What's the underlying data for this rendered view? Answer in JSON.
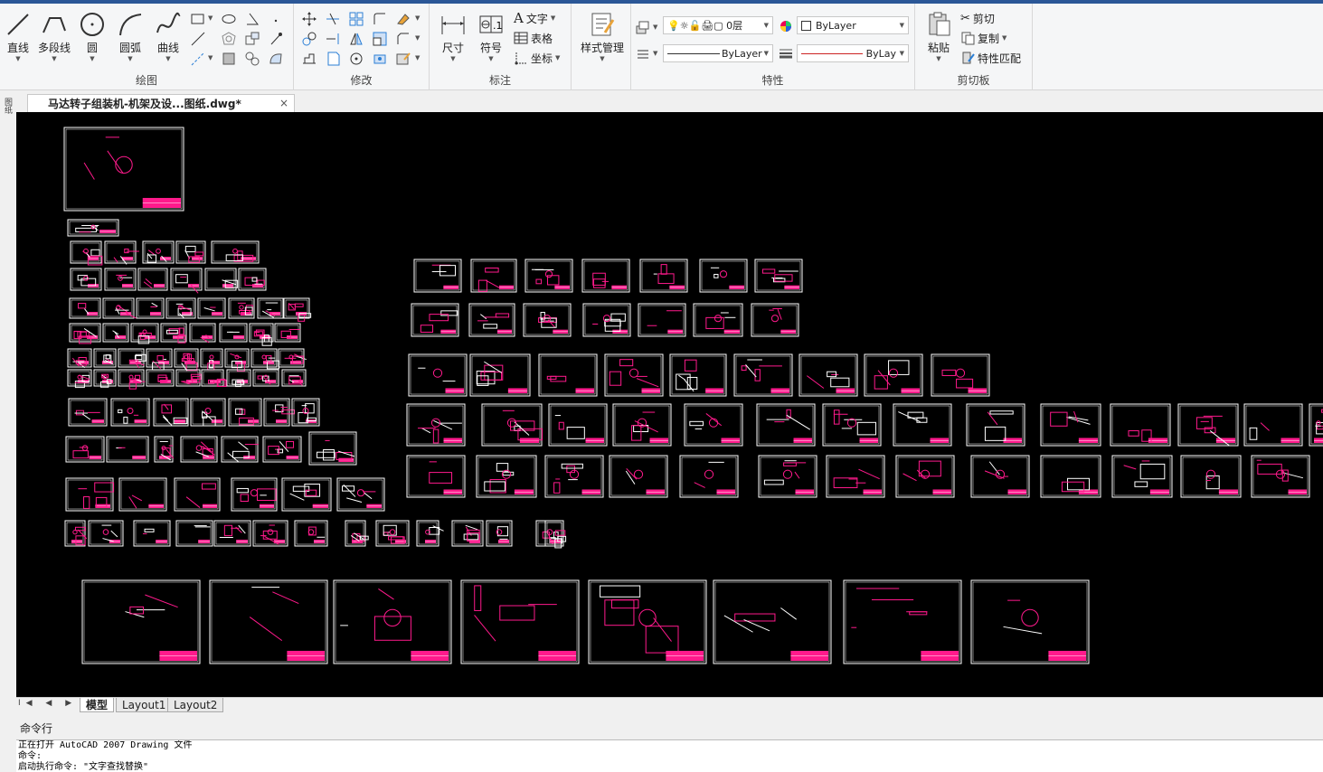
{
  "ribbon": {
    "draw": {
      "label": "绘图",
      "line": "直线",
      "polyline": "多段线",
      "circle": "圆",
      "arc": "圆弧",
      "curve": "曲线"
    },
    "modify": {
      "label": "修改"
    },
    "annotate": {
      "label": "标注",
      "dimension": "尺寸",
      "symbol": "符号",
      "text": "文字",
      "table": "表格",
      "coord": "坐标"
    },
    "style": {
      "label": "样式管理"
    },
    "properties": {
      "label": "特性",
      "layer_value": "0层",
      "color_value": "ByLayer",
      "linetype_value": "ByLayer",
      "lineweight_value": "ByLay"
    },
    "clipboard": {
      "label": "剪切板",
      "paste": "粘贴",
      "cut": "剪切",
      "copy": "复制",
      "match": "特性匹配"
    }
  },
  "document": {
    "tab_title": "马达转子组装机-机架及设...图纸.dwg*",
    "close_glyph": "×"
  },
  "left_strip": {
    "text": "图纸"
  },
  "layout_tabs": {
    "nav": "I◀ ◀ ▶ ▶I",
    "tabs": [
      "模型",
      "Layout1",
      "Layout2"
    ]
  },
  "command": {
    "title": "命令行",
    "lines": [
      "正在打开 AutoCAD 2007 Drawing 文件",
      "命令:",
      "启动执行命令: \"文字查找替换\""
    ]
  },
  "colors": {
    "accent": "#2b5797",
    "canvas": "#000000",
    "drawing_white": "#ffffff",
    "drawing_magenta": "#ff1a8c"
  }
}
